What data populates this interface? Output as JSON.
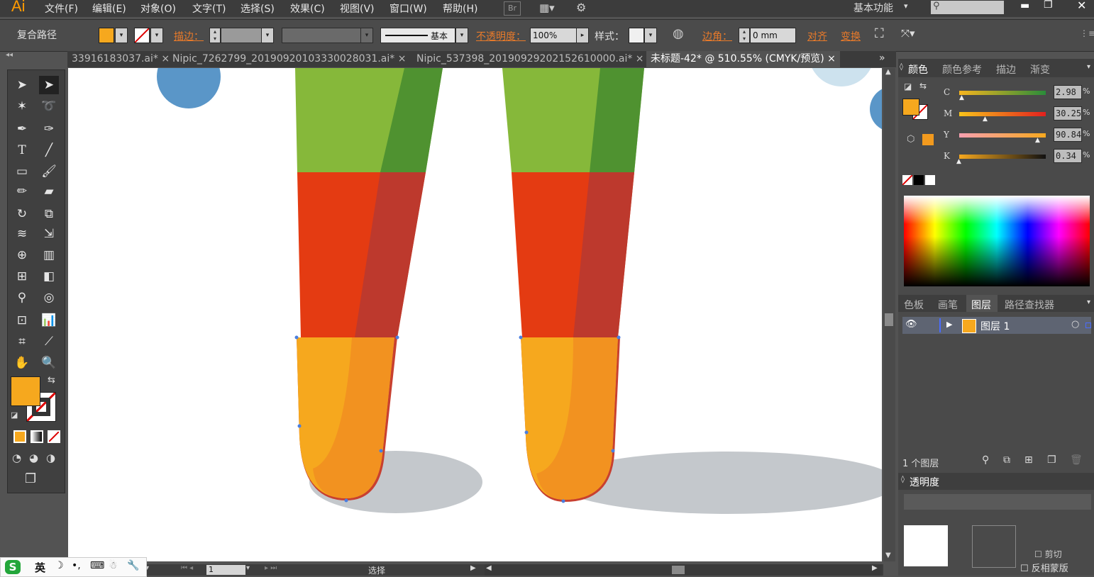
{
  "app": {
    "logo": "Ai"
  },
  "menu": {
    "items": [
      "文件(F)",
      "编辑(E)",
      "对象(O)",
      "文字(T)",
      "选择(S)",
      "效果(C)",
      "视图(V)",
      "窗口(W)",
      "帮助(H)"
    ],
    "br": "Br",
    "workspace": "基本功能"
  },
  "control": {
    "object_type": "复合路径",
    "stroke_label": "描边：",
    "stroke_style": "基本",
    "opacity_label": "不透明度：",
    "opacity_value": "100%",
    "style_label": "样式：",
    "corner_label": "边角：",
    "corner_value": "0 mm",
    "align_label": "对齐",
    "transform_label": "变换"
  },
  "tabs": [
    "33916183037.ai*",
    "Nipic_7262799_20190920103330028031.ai*",
    "Nipic_537398_20190929202152610000.ai*",
    "未标题-42* @ 510.55% (CMYK/预览)"
  ],
  "colors": {
    "fill": "#f6a81e",
    "accent": "#e87a2a"
  },
  "color_panel": {
    "tabs": [
      "颜色",
      "颜色参考",
      "描边",
      "渐变"
    ],
    "channels": [
      {
        "name": "C",
        "value": "2.98",
        "level": 0.03
      },
      {
        "name": "M",
        "value": "30.25",
        "level": 0.3
      },
      {
        "name": "Y",
        "value": "90.84",
        "level": 0.91
      },
      {
        "name": "K",
        "value": "0.34",
        "level": 0.0
      }
    ],
    "percent": "%"
  },
  "layers_panel": {
    "tabs": [
      "色板",
      "画笔",
      "图层",
      "路径查找器"
    ],
    "layer_name": "图层 1",
    "count": "1 个图层"
  },
  "transparency_panel": {
    "title": "透明度",
    "clip": "剪切",
    "invert_mask": "反相蒙版"
  },
  "status": {
    "page": "1",
    "mode": "选择"
  },
  "ime": {
    "lang": "英"
  }
}
